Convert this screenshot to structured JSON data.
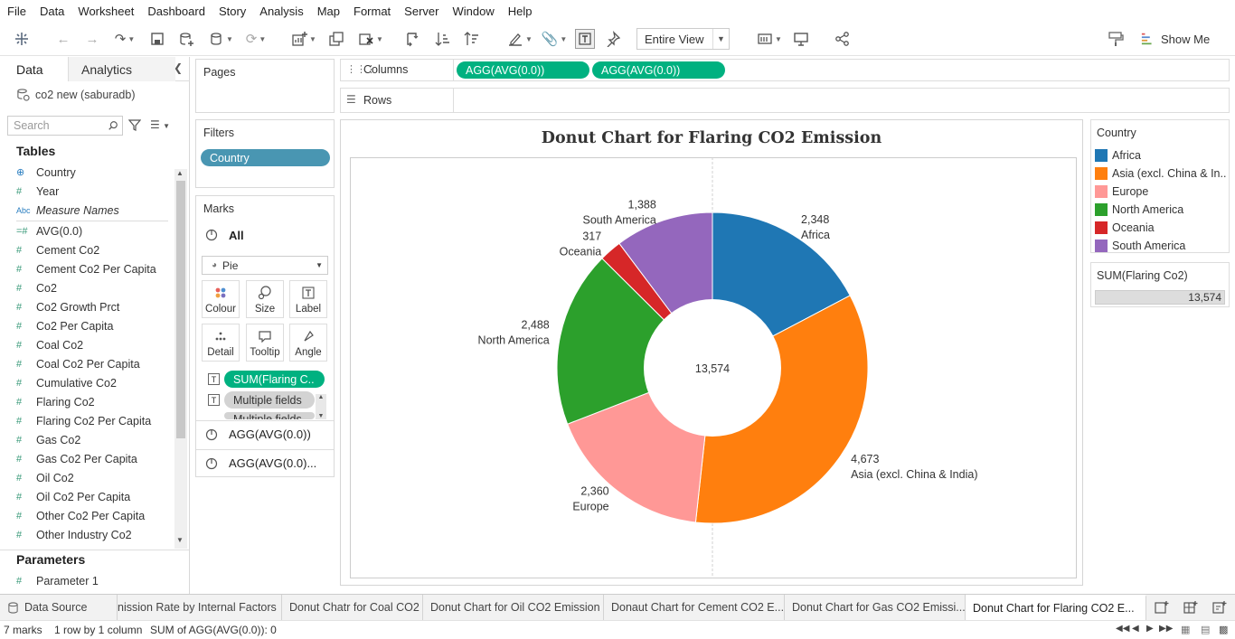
{
  "menu": [
    "File",
    "Data",
    "Worksheet",
    "Dashboard",
    "Story",
    "Analysis",
    "Map",
    "Format",
    "Server",
    "Window",
    "Help"
  ],
  "toolbar": {
    "view_mode": "Entire View",
    "show_me": "Show Me"
  },
  "left_pane": {
    "tab_data": "Data",
    "tab_analytics": "Analytics",
    "datasource": "co2 new (saburadb)",
    "search_placeholder": "Search",
    "tables_title": "Tables",
    "fields": [
      {
        "icon": "globe-icon",
        "name": "Country",
        "kind": "geo"
      },
      {
        "icon": "hash-icon",
        "name": "Year",
        "kind": "num"
      },
      {
        "icon": "abc-icon",
        "name": "Measure Names",
        "kind": "abc"
      },
      {
        "icon": "hash-icon",
        "name": "AVG(0.0)",
        "kind": "calc"
      },
      {
        "icon": "hash-icon",
        "name": "Cement Co2",
        "kind": "num"
      },
      {
        "icon": "hash-icon",
        "name": "Cement Co2 Per Capita",
        "kind": "num"
      },
      {
        "icon": "hash-icon",
        "name": "Co2",
        "kind": "num"
      },
      {
        "icon": "hash-icon",
        "name": "Co2 Growth Prct",
        "kind": "num"
      },
      {
        "icon": "hash-icon",
        "name": "Co2 Per Capita",
        "kind": "num"
      },
      {
        "icon": "hash-icon",
        "name": "Coal Co2",
        "kind": "num"
      },
      {
        "icon": "hash-icon",
        "name": "Coal Co2 Per Capita",
        "kind": "num"
      },
      {
        "icon": "hash-icon",
        "name": "Cumulative Co2",
        "kind": "num"
      },
      {
        "icon": "hash-icon",
        "name": "Flaring Co2",
        "kind": "num"
      },
      {
        "icon": "hash-icon",
        "name": "Flaring Co2 Per Capita",
        "kind": "num"
      },
      {
        "icon": "hash-icon",
        "name": "Gas Co2",
        "kind": "num"
      },
      {
        "icon": "hash-icon",
        "name": "Gas Co2 Per Capita",
        "kind": "num"
      },
      {
        "icon": "hash-icon",
        "name": "Oil Co2",
        "kind": "num"
      },
      {
        "icon": "hash-icon",
        "name": "Oil Co2 Per Capita",
        "kind": "num"
      },
      {
        "icon": "hash-icon",
        "name": "Other Co2 Per Capita",
        "kind": "num"
      },
      {
        "icon": "hash-icon",
        "name": "Other Industry Co2",
        "kind": "num"
      }
    ],
    "parameters_title": "Parameters",
    "parameters": [
      "Parameter 1"
    ]
  },
  "shelves": {
    "pages": "Pages",
    "filters": "Filters",
    "filter_pill": "Country",
    "columns": "Columns",
    "columns_pills": [
      "AGG(AVG(0.0))",
      "AGG(AVG(0.0))"
    ],
    "rows": "Rows"
  },
  "marks": {
    "title": "Marks",
    "all": "All",
    "type": "Pie",
    "buttons": [
      "Colour",
      "Size",
      "Label",
      "Detail",
      "Tooltip",
      "Angle"
    ],
    "fields": [
      "SUM(Flaring C..",
      "Multiple fields",
      "Multiple fields"
    ],
    "sub_cards": [
      "AGG(AVG(0.0))",
      "AGG(AVG(0.0)..."
    ]
  },
  "chart_data": {
    "type": "pie",
    "title": "Donut Chart for Flaring CO2 Emission",
    "center_label": "13,574",
    "total": 13574,
    "series": [
      {
        "category": "Africa",
        "value": 2348,
        "label": "2,348",
        "color": "#1f77b4"
      },
      {
        "category": "Asia (excl. China & India)",
        "value": 4673,
        "label": "4,673",
        "color": "#ff7f0e"
      },
      {
        "category": "Europe",
        "value": 2360,
        "label": "2,360",
        "color": "#ff9896"
      },
      {
        "category": "North America",
        "value": 2488,
        "label": "2,488",
        "color": "#2ca02c"
      },
      {
        "category": "Oceania",
        "value": 317,
        "label": "317",
        "color": "#d62728"
      },
      {
        "category": "South America",
        "value": 1388,
        "label": "1,388",
        "color": "#9467bd"
      }
    ]
  },
  "legend": {
    "title": "Country",
    "items": [
      {
        "label": "Africa",
        "color": "#1f77b4"
      },
      {
        "label": "Asia (excl. China & In..",
        "color": "#ff7f0e"
      },
      {
        "label": "Europe",
        "color": "#ff9896"
      },
      {
        "label": "North America",
        "color": "#2ca02c"
      },
      {
        "label": "Oceania",
        "color": "#d62728"
      },
      {
        "label": "South America",
        "color": "#9467bd"
      }
    ],
    "size_title": "SUM(Flaring Co2)",
    "size_value": "13,574"
  },
  "sheet_tabs": [
    "Data Source",
    "nission Rate by Internal Factors",
    "Donut Chatr for Coal CO2",
    "Donut Chart for Oil CO2 Emission",
    "Donaut Chart for Cement CO2 E...",
    "Donut Chart for Gas CO2 Emissi...",
    "Donut Chart for Flaring CO2 E..."
  ],
  "status": {
    "marks": "7 marks",
    "rows_cols": "1 row by 1 column",
    "sum": "SUM of AGG(AVG(0.0)): 0"
  }
}
